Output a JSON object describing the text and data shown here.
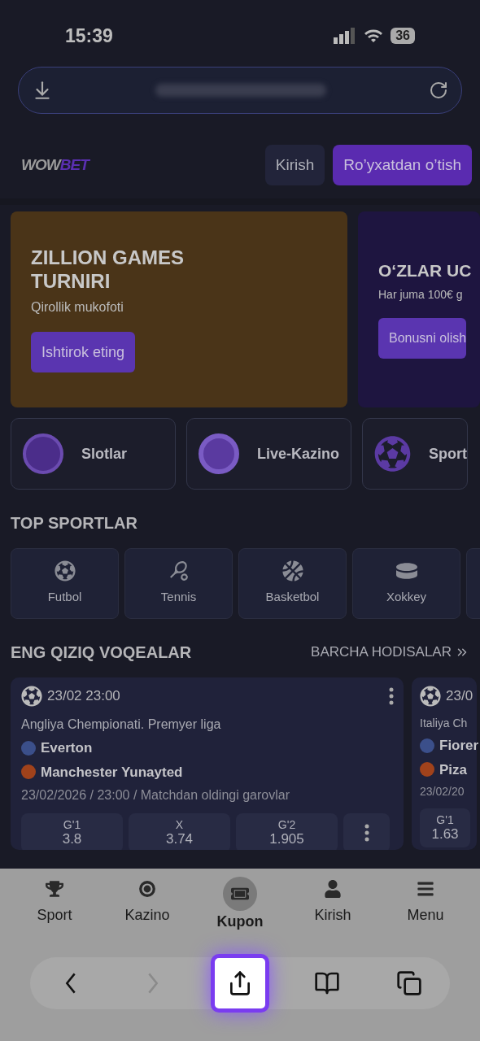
{
  "status_bar": {
    "time": "15:39",
    "battery": "36"
  },
  "header": {
    "logo": {
      "first": "WOW",
      "second": "BET"
    },
    "buttons": [
      {
        "label": "Kirish",
        "kind": "secondary"
      },
      {
        "label": "Ro’yxatdan o’tish",
        "kind": "primary"
      }
    ]
  },
  "banners": [
    {
      "kind": "photo",
      "title": "ZILLION GAMES TURNIRI",
      "subtitle": "Qirollik mukofoti",
      "button": "Ishtirok eting"
    },
    {
      "kind": "plain",
      "title": "O‘ZLAR UC",
      "subtitle": "Har juma 100€ g",
      "button": "Bonusni olish"
    }
  ],
  "categories": [
    {
      "kind": "slots",
      "label": "Slotlar"
    },
    {
      "kind": "live",
      "label": "Live-Kazino"
    },
    {
      "kind": "sport",
      "label": "Sport"
    }
  ],
  "top_sports": {
    "title": "TOP SPORTLAR",
    "items": [
      {
        "kind": "football",
        "label": "Futbol"
      },
      {
        "kind": "tennis",
        "label": "Tennis"
      },
      {
        "kind": "basketball",
        "label": "Basketbol"
      },
      {
        "kind": "hockey",
        "label": "Xokkey"
      }
    ]
  },
  "events": {
    "title": "ENG QIZIQ VOQEALAR",
    "link": "BARCHA HODISALAR",
    "items": [
      {
        "time": "23/02 23:00",
        "league": "Angliya Chempionati. Premyer liga",
        "teams": [
          "Everton",
          "Manchester Yunayted"
        ],
        "info": "23/02/2026 / 23:00 / Matchdan oldingi garovlar",
        "odds": [
          {
            "label": "G'1",
            "value": "3.8"
          },
          {
            "label": "X",
            "value": "3.74"
          },
          {
            "label": "G'2",
            "value": "1.905"
          }
        ]
      },
      {
        "time": "23/0",
        "league": "Italiya Ch",
        "teams": [
          "Fiorer",
          "Piza"
        ],
        "info": "23/02/20",
        "odds": [
          {
            "label": "G'1",
            "value": "1.63"
          }
        ]
      }
    ]
  },
  "bottom_nav": [
    {
      "kind": "trophy",
      "label": "Sport",
      "selected": false
    },
    {
      "kind": "chip",
      "label": "Kazino",
      "selected": false
    },
    {
      "kind": "ticket",
      "label": "Kupon",
      "selected": true
    },
    {
      "kind": "user",
      "label": "Kirish",
      "selected": false
    },
    {
      "kind": "menu",
      "label": "Menu",
      "selected": false
    }
  ],
  "browser_toolbar": [
    {
      "kind": "back",
      "disabled": false,
      "highlighted": false
    },
    {
      "kind": "forward",
      "disabled": true,
      "highlighted": false
    },
    {
      "kind": "share",
      "disabled": false,
      "highlighted": true
    },
    {
      "kind": "bookmarks",
      "disabled": false,
      "highlighted": false
    },
    {
      "kind": "tabs",
      "disabled": false,
      "highlighted": false
    }
  ]
}
